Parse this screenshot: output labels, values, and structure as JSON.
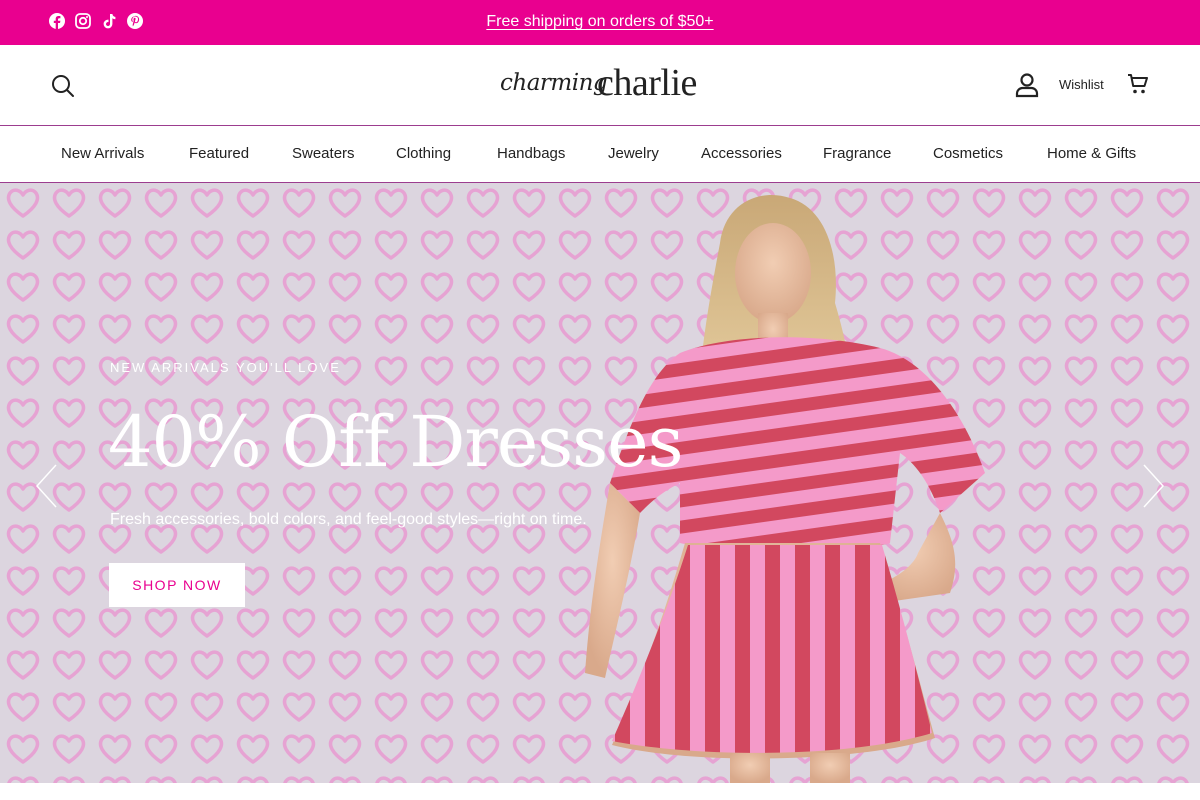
{
  "announcement": {
    "text": "Free shipping on orders of $50+"
  },
  "social": {
    "icons": [
      "facebook-icon",
      "instagram-icon",
      "tiktok-icon",
      "pinterest-icon"
    ]
  },
  "header": {
    "logo_script": "charming",
    "logo_main": "charlie",
    "wishlist_label": "Wishlist",
    "icons": {
      "search": "search-icon",
      "account": "account-icon",
      "cart": "cart-icon"
    }
  },
  "nav": {
    "items": [
      "New Arrivals",
      "Featured",
      "Sweaters",
      "Clothing",
      "Handbags",
      "Jewelry",
      "Accessories",
      "Fragrance",
      "Cosmetics",
      "Home & Gifts"
    ]
  },
  "hero": {
    "eyebrow": "NEW ARRIVALS YOU'LL LOVE",
    "title": "40% Off Dresses",
    "subtitle": "Fresh accessories, bold colors, and feel-good styles—right on time.",
    "cta_label": "SHOP NOW"
  },
  "colors": {
    "brand_pink": "#e9008f",
    "nav_border": "#9c3d8f",
    "hero_bg": "#dcd5df",
    "heart_pink": "#e6a3d3",
    "dress_pink": "#f49ac9",
    "dress_red": "#d2485f"
  }
}
